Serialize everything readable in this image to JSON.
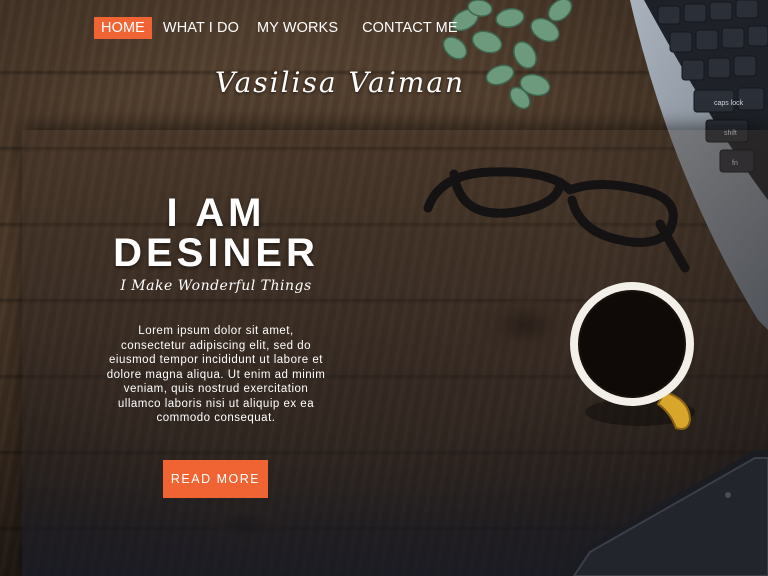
{
  "nav": {
    "items": [
      {
        "label": "HOME",
        "active": true
      },
      {
        "label": "WHAT I DO",
        "active": false
      },
      {
        "label": "MY WORKS",
        "active": false
      },
      {
        "label": "CONTACT ME",
        "active": false
      }
    ]
  },
  "brand": {
    "name": "Vasilisa Vaiman"
  },
  "hero": {
    "title_line1": "I AM",
    "title_line2": "DESINER",
    "subtitle": "I Make Wonderful Things",
    "body": "Lorem ipsum dolor sit amet, consectetur adipiscing elit, sed do eiusmod tempor incididunt ut labore et dolore magna aliqua. Ut enim ad minim veniam, quis nostrud exercitation ullamco laboris nisi ut aliquip ex ea commodo consequat.",
    "cta_label": "READ MORE"
  },
  "colors": {
    "accent": "#f06433",
    "text": "#ffffff"
  },
  "decor": {
    "keyboard_keys": [
      "caps lock",
      "shift",
      "fn"
    ],
    "icons": [
      "plant-icon",
      "laptop-icon",
      "glasses-icon",
      "coffee-mug-icon",
      "phone-icon"
    ]
  }
}
